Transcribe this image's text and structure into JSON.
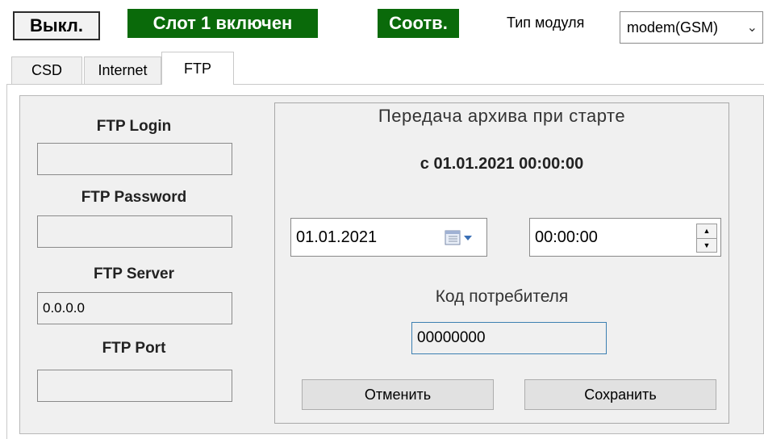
{
  "topbar": {
    "off_button": "Выкл.",
    "slot_status": "Слот 1 включен",
    "match_status": "Соотв.",
    "module_type_label": "Тип модуля",
    "module_type_value": "modem(GSM)"
  },
  "tabs": [
    {
      "label": "CSD"
    },
    {
      "label": "Internet"
    },
    {
      "label": "FTP",
      "active": true
    }
  ],
  "ftp": {
    "login_label": "FTP Login",
    "login_value": "",
    "password_label": "FTP Password",
    "password_value": "",
    "server_label": "FTP Server",
    "server_value": "0.0.0.0",
    "port_label": "FTP Port",
    "port_value": ""
  },
  "archive": {
    "title": "Передача архива при старте",
    "since_text": "с 01.01.2021 00:00:00",
    "date_value": "01.01.2021",
    "time_value": "00:00:00",
    "consumer_code_label": "Код потребителя",
    "consumer_code_value": "00000000",
    "cancel_label": "Отменить",
    "save_label": "Сохранить"
  },
  "colors": {
    "status_green": "#0a6a0a",
    "panel_bg": "#f0f0f0",
    "focus_border": "#3c7fb1"
  },
  "icons": {
    "module_dropdown": "chevron-down-icon",
    "date_picker": "calendar-icon",
    "time_spinner": "spinner-arrows-icon"
  }
}
